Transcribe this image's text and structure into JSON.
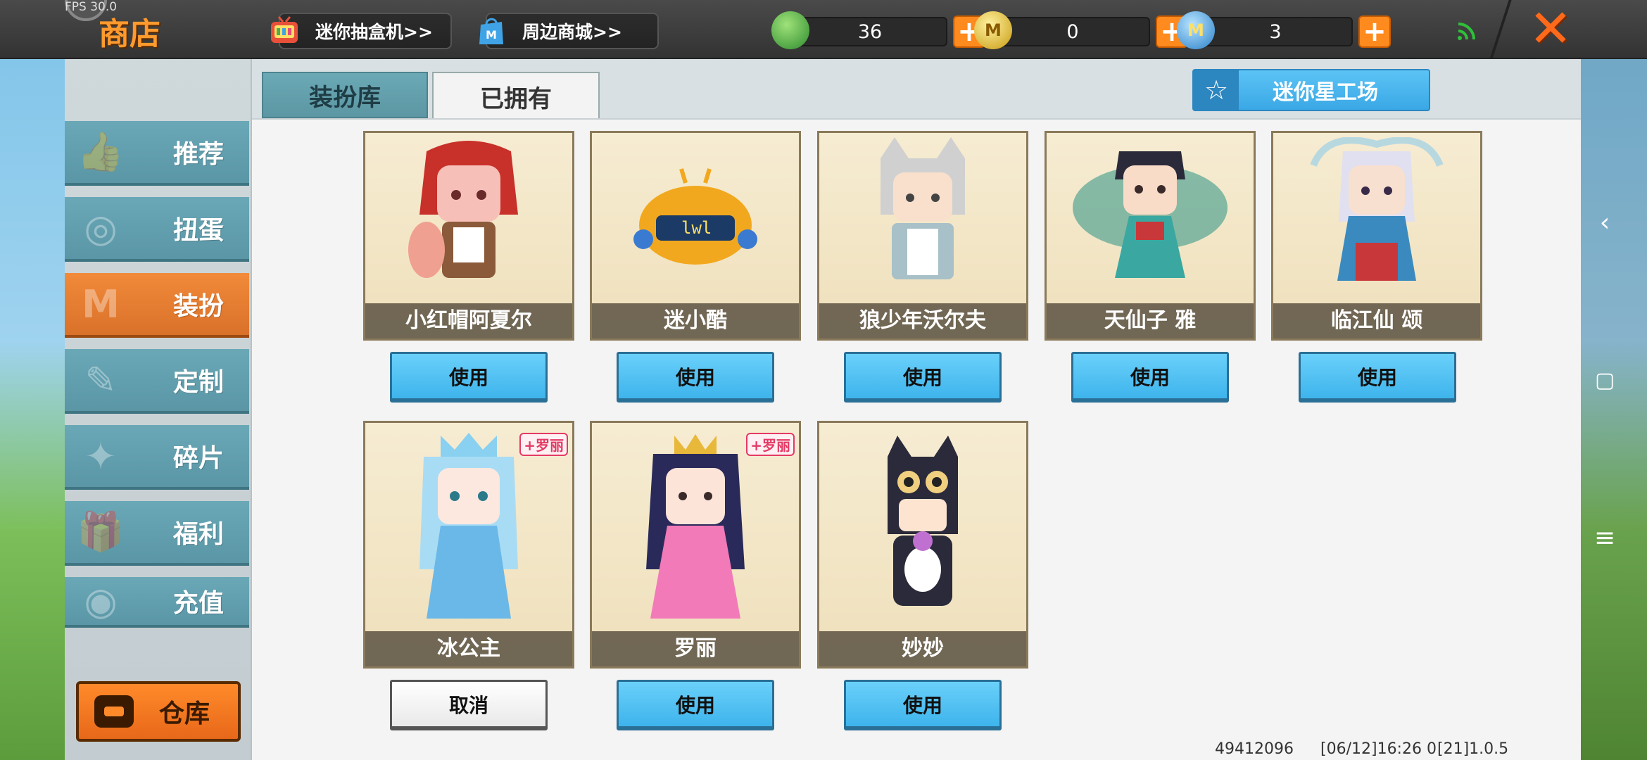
{
  "topbar": {
    "fps": "FPS 30.0",
    "title": "商店",
    "links": [
      {
        "label": "迷你抽盒机>>",
        "icon": "blind-box-tv-icon"
      },
      {
        "label": "周边商城>>",
        "icon": "shopping-bag-icon"
      }
    ],
    "currencies": [
      {
        "name": "green-gem",
        "value": "36",
        "color": "#4caf50"
      },
      {
        "name": "mini-coin",
        "value": "0",
        "color": "#e8c42a"
      },
      {
        "name": "mini-bean",
        "value": "3",
        "color": "#3fa3e6"
      }
    ],
    "plus_label": "+",
    "close_label": "✕"
  },
  "tabs": {
    "library": "装扮库",
    "owned": "已拥有",
    "factory": "迷你星工场"
  },
  "sidebar": {
    "items": [
      {
        "label": "推荐",
        "icon": "thumbs-up-icon"
      },
      {
        "label": "扭蛋",
        "icon": "capsule-icon"
      },
      {
        "label": "装扮",
        "icon": "shirt-icon"
      },
      {
        "label": "定制",
        "icon": "pencil-icon"
      },
      {
        "label": "碎片",
        "icon": "puzzle-cat-icon"
      },
      {
        "label": "福利",
        "icon": "gift-icon"
      },
      {
        "label": "充值",
        "icon": "coins-icon"
      }
    ],
    "warehouse": "仓库"
  },
  "skins": [
    {
      "name": "小红帽阿夏尔",
      "button": "使用",
      "badge": ""
    },
    {
      "name": "迷小酷",
      "button": "使用",
      "badge": ""
    },
    {
      "name": "狼少年沃尔夫",
      "button": "使用",
      "badge": ""
    },
    {
      "name": "天仙子 雅",
      "button": "使用",
      "badge": ""
    },
    {
      "name": "临江仙 颂",
      "button": "使用",
      "badge": ""
    },
    {
      "name": "冰公主",
      "button": "取消",
      "badge": "+罗丽"
    },
    {
      "name": "罗丽",
      "button": "使用",
      "badge": "+罗丽"
    },
    {
      "name": "妙妙",
      "button": "使用",
      "badge": ""
    }
  ],
  "footer": {
    "uid": "49412096",
    "time": "[06/12]16:26 0",
    "version": "[21]1.0.5"
  },
  "system_nav": {
    "back": "‹",
    "home": "▢",
    "menu": "≡"
  }
}
